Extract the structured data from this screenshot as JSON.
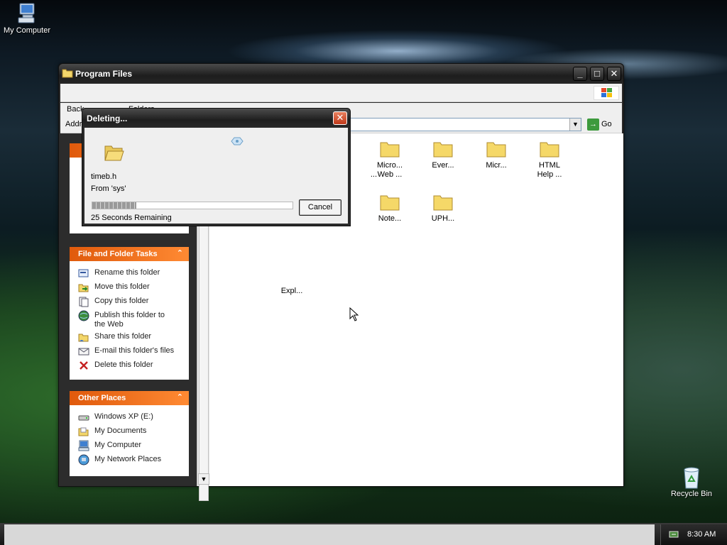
{
  "desktop": {
    "icons": [
      {
        "label": "My Computer",
        "icon": "my-computer-icon"
      },
      {
        "label": "Recycle Bin",
        "icon": "recycle-bin-icon"
      }
    ]
  },
  "window": {
    "title": "Program Files",
    "toolbar": {
      "back_label": "Back",
      "folders_label": "Folders"
    },
    "address": {
      "label": "Address",
      "go_label": "Go",
      "value": ""
    },
    "file_folder_tasks": {
      "title": "File and Folder Tasks",
      "items": [
        "Rename this folder",
        "Move this folder",
        "Copy this folder",
        "Publish this folder to the Web",
        "E-mail this folder's files",
        "Delete this folder"
      ]
    },
    "share_item": "Share this folder",
    "other_places": {
      "title": "Other Places",
      "items": [
        "Windows XP (E:)",
        "My Documents",
        "My Computer",
        "My Network Places"
      ]
    },
    "files": [
      {
        "name": "...",
        "row": 1,
        "col": 0
      },
      {
        "name": "Micro... Web ...",
        "row": 1,
        "col": 1
      },
      {
        "name": "Ever...",
        "row": 1,
        "col": 2
      },
      {
        "name": "Micr...",
        "row": 1,
        "col": 3
      },
      {
        "name": "HTML Help ...",
        "row": 1,
        "col": 4
      },
      {
        "name": "Expl...",
        "row": 2,
        "col": -1
      },
      {
        "name": "Note...",
        "row": 2,
        "col": 1
      },
      {
        "name": "UPH...",
        "row": 2,
        "col": 2
      }
    ]
  },
  "dialog": {
    "title": "Deleting...",
    "file_name": "timeb.h",
    "from": "From 'sys'",
    "remaining": "25 Seconds Remaining",
    "cancel_label": "Cancel",
    "progress": 0.22
  },
  "taskbar": {
    "clock": "8:30 AM"
  },
  "colors": {
    "panel_header_start": "#e05a0c",
    "panel_header_end": "#ff8a33",
    "window_frame": "#2b2b2b",
    "dialog_close": "#c0391a",
    "go_arrow": "#3d9a3d"
  }
}
